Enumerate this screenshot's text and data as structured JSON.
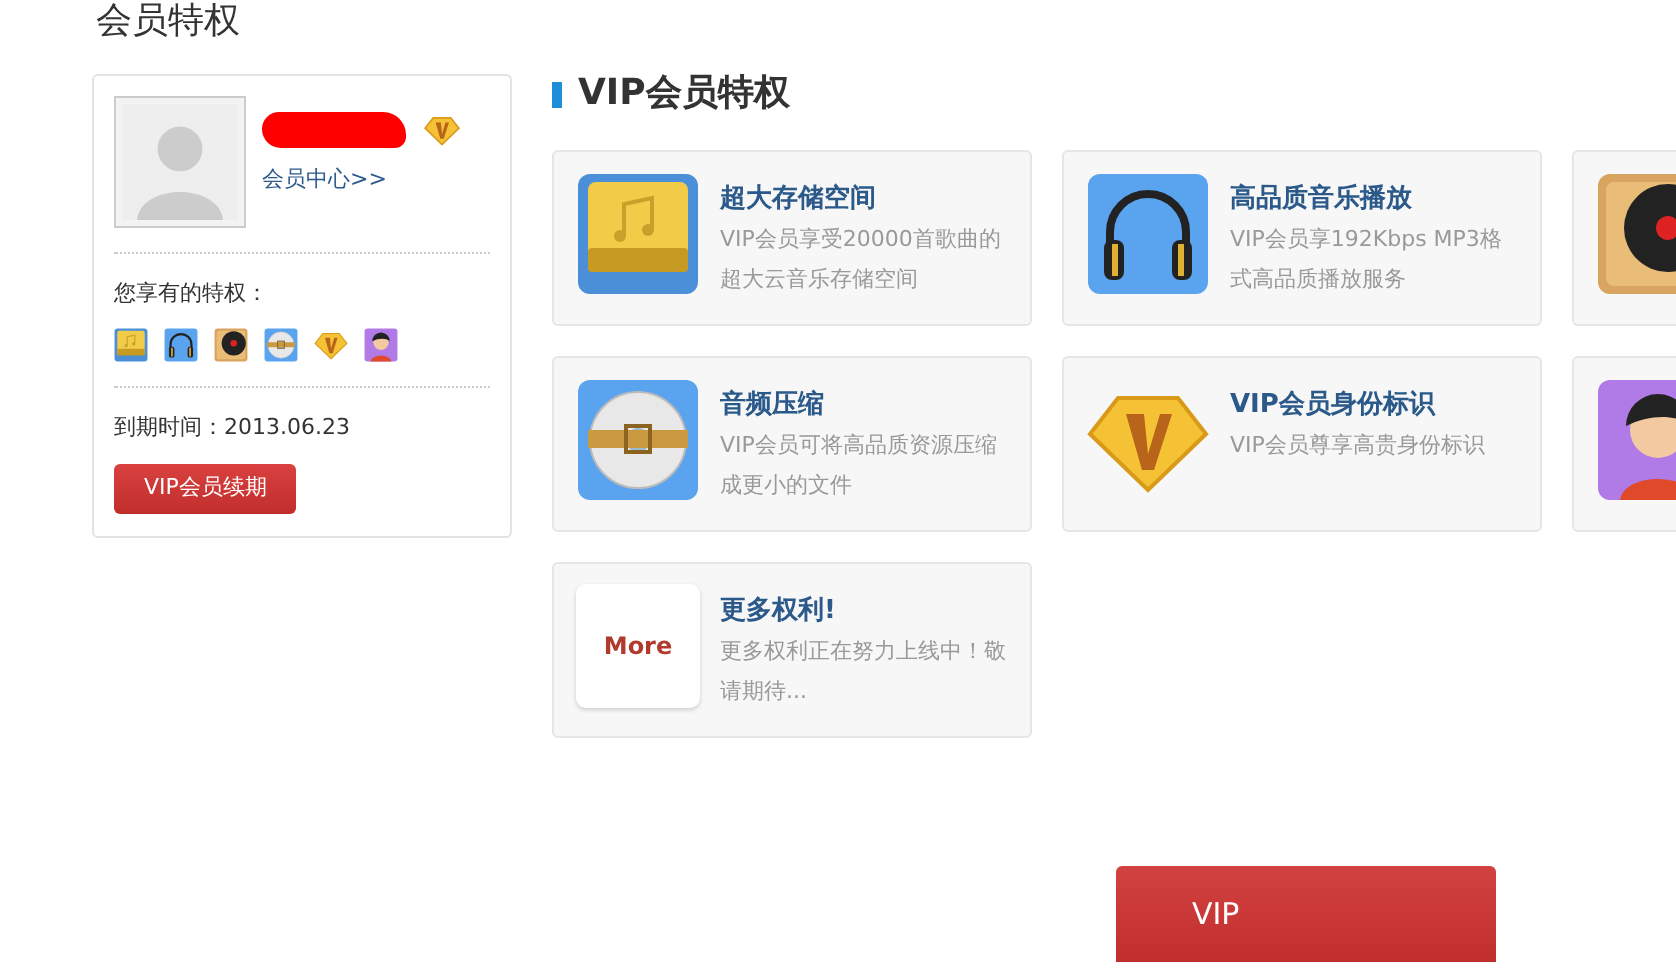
{
  "page_title": "会员特权",
  "profile": {
    "member_center_link": "会员中心>>",
    "privileges_label": "您享有的特权：",
    "expiry_label": "到期时间：",
    "expiry_date": "2013.06.23",
    "renew_button": "VIP会员续期"
  },
  "section_title": "VIP会员特权",
  "features": [
    {
      "kind": "storage",
      "title": "超大存储空间",
      "description": "VIP会员享受20000首歌曲的超大云音乐存储空间"
    },
    {
      "kind": "headphones",
      "title": "高品质音乐播放",
      "description": "VIP会员享192Kbps MP3格式高品质播放服务"
    },
    {
      "kind": "record"
    },
    {
      "kind": "disc",
      "title": "音频压缩",
      "description": "VIP会员可将高品质资源压缩成更小的文件"
    },
    {
      "kind": "badge",
      "title": "VIP会员身份标识",
      "description": "VIP会员尊享高贵身份标识"
    },
    {
      "kind": "avatar"
    },
    {
      "kind": "more",
      "icon_text": "More",
      "title": "更多权利!",
      "description": "更多权利正在努力上线中！敬请期待..."
    }
  ],
  "bottom_button": "VIP"
}
